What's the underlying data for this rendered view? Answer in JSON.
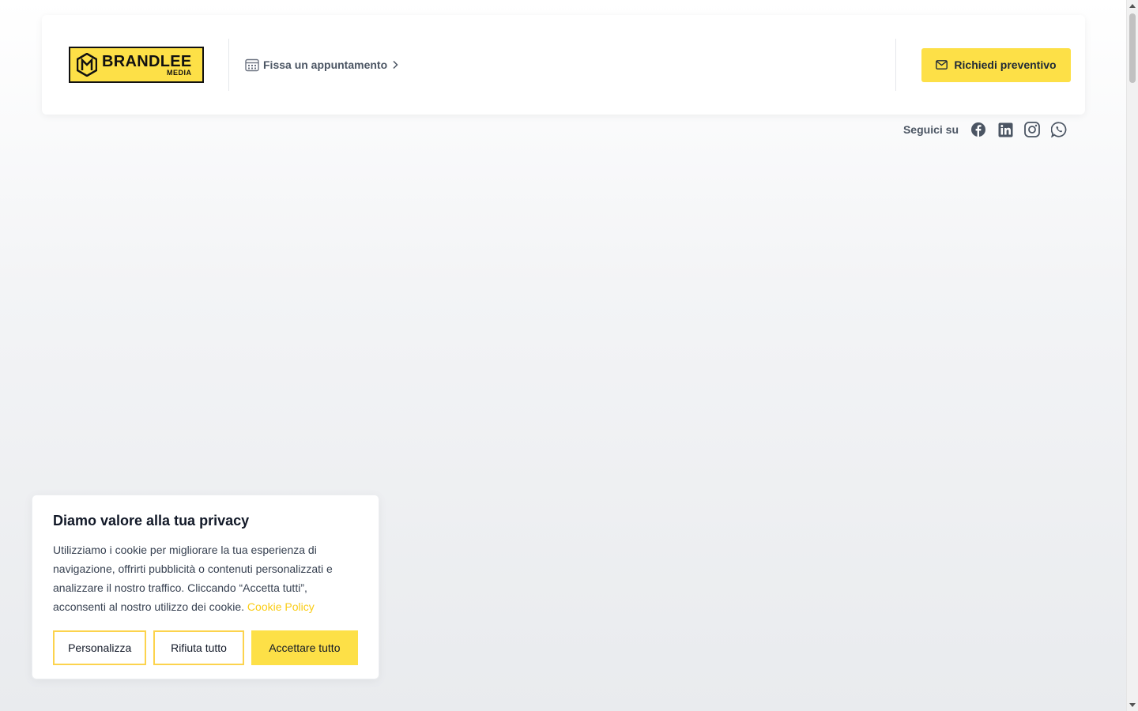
{
  "header": {
    "logo": {
      "brand": "BRANDLEE",
      "sub": "MEDIA"
    },
    "appointment_label": "Fissa un appuntamento",
    "quote_button_label": "Richiedi preventivo"
  },
  "social": {
    "label": "Seguici su",
    "icons": [
      "facebook-icon",
      "linkedin-icon",
      "instagram-icon",
      "whatsapp-icon"
    ]
  },
  "cookie_banner": {
    "title": "Diamo valore alla tua privacy",
    "text": "Utilizziamo i cookie per migliorare la tua esperienza di navigazione, offrirti pubblicità o contenuti personalizzati e analizzare il nostro traffico. Cliccando “Accetta tutti”, acconsenti al nostro utilizzo dei cookie.",
    "link_label": "Cookie Policy",
    "buttons": {
      "customize": "Personalizza",
      "reject": "Rifiuta tutto",
      "accept": "Accettare tutto"
    }
  },
  "colors": {
    "accent": "#fde047",
    "link": "#facc15"
  }
}
